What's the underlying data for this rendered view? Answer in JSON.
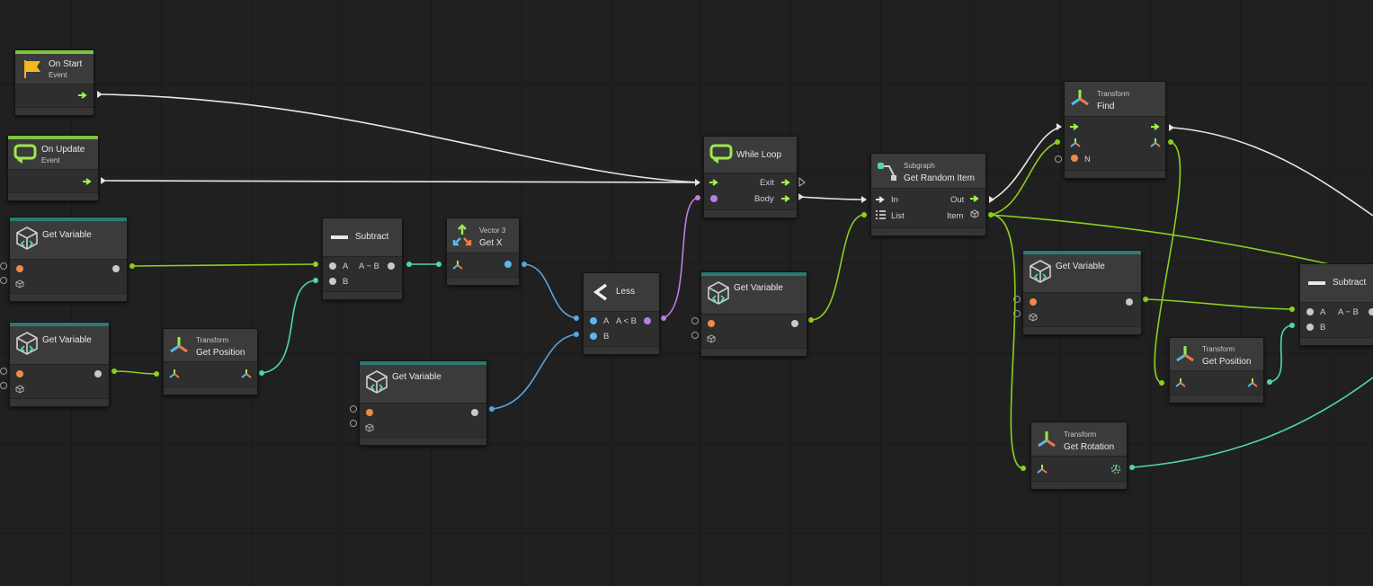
{
  "colors": {
    "background": "#202020",
    "node_body": "#2e2e2e",
    "event_accent": "#7fc241",
    "variable_accent": "#2a7a75",
    "flow_arrow": "#9dff4a",
    "wire_flow": "#e6e6e6",
    "wire_green": "#8cd01d",
    "wire_teal": "#4fd6b4",
    "wire_blue": "#5aa6e0",
    "wire_purple": "#c27ee0"
  },
  "nodes": {
    "on_start": {
      "title": "On Start",
      "subtitle": "Event",
      "icon": "flag-icon"
    },
    "on_update": {
      "title": "On Update",
      "subtitle": "Event",
      "icon": "loop-icon"
    },
    "get_var_1": {
      "title": "Get Variable",
      "icon": "variable-cube-icon"
    },
    "get_var_2": {
      "title": "Get Variable",
      "icon": "variable-cube-icon"
    },
    "get_position_1": {
      "category": "Transform",
      "title": "Get Position",
      "icon": "transform-axes-icon"
    },
    "subtract_1": {
      "title": "Subtract",
      "in_a": "A",
      "in_b": "B",
      "out": "A − B",
      "icon": "minus-icon"
    },
    "vector3_get_x": {
      "category": "Vector 3",
      "title": "Get X",
      "icon": "vector3-icon"
    },
    "get_var_3": {
      "title": "Get Variable",
      "icon": "variable-cube-icon"
    },
    "less": {
      "title": "Less",
      "in_a": "A",
      "in_b": "B",
      "out": "A < B",
      "icon": "less-than-icon"
    },
    "while_loop": {
      "title": "While Loop",
      "out_exit": "Exit",
      "out_body": "Body",
      "icon": "loop-icon"
    },
    "get_var_4": {
      "title": "Get Variable",
      "icon": "variable-cube-icon"
    },
    "subgraph": {
      "category": "Subgraph",
      "title": "Get Random Item",
      "in_flow": "In",
      "in_list": "List",
      "out_flow": "Out",
      "out_item": "Item",
      "icon": "subgraph-icon"
    },
    "transform_find": {
      "category": "Transform",
      "title": "Find",
      "in_n": "N",
      "icon": "transform-axes-icon"
    },
    "get_var_5": {
      "title": "Get Variable",
      "icon": "variable-cube-icon"
    },
    "get_position_2": {
      "category": "Transform",
      "title": "Get Position",
      "icon": "transform-axes-icon"
    },
    "get_rotation": {
      "category": "Transform",
      "title": "Get Rotation",
      "icon": "transform-axes-icon"
    },
    "subtract_2": {
      "title": "Subtract",
      "in_a": "A",
      "in_b": "B",
      "out": "A − B",
      "icon": "minus-icon"
    }
  }
}
